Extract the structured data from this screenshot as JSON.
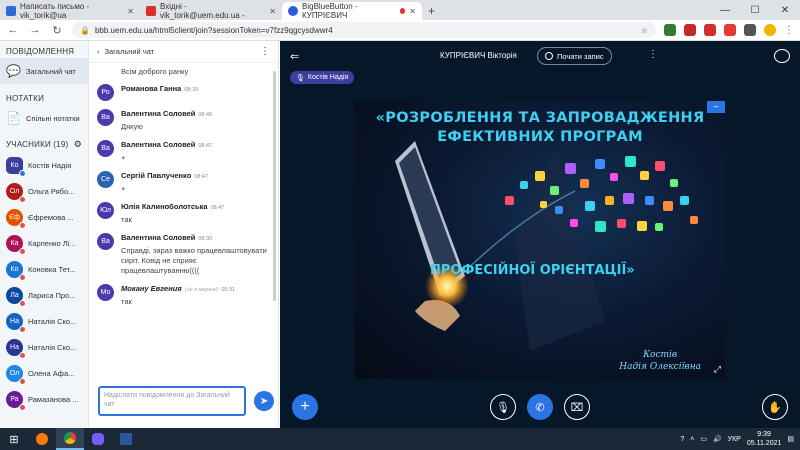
{
  "browser": {
    "tabs": [
      {
        "label": "Написать письмо - vik_torik@ua",
        "fav_color": "#2a6bd5",
        "active": false
      },
      {
        "label": "Вхідні - vik_torik@uem.edu.ua - ",
        "fav_color": "#d93025",
        "active": false
      },
      {
        "label": "BigBlueButton - КУПРІЄВИЧ",
        "fav_color": "#2a5bd8",
        "active": true
      }
    ],
    "new_tab": "+",
    "url": "bbb.uem.edu.ua/html5client/join?sessionToken=v7fzz9qgcysdwwr4"
  },
  "nav": {
    "messages_header": "ПОВІДОМЛЕННЯ",
    "public_chat": "Загальний чат",
    "notes_header": "НОТАТКИ",
    "shared_notes": "Спільні нотатки",
    "participants_header": "УЧАСНИКИ (19)",
    "participants": [
      {
        "initials": "Ко",
        "name": "Костів Надія",
        "color": "#3d3f9e",
        "shape": "square",
        "presenter": true
      },
      {
        "initials": "Ол",
        "name": "Ольга Рябо...",
        "color": "#b71c1c",
        "shape": "round"
      },
      {
        "initials": "Єф",
        "name": "Єфремова ...",
        "color": "#e65100",
        "shape": "round"
      },
      {
        "initials": "Ка",
        "name": "Карпенко Лі...",
        "color": "#ad1457",
        "shape": "round"
      },
      {
        "initials": "Ко",
        "name": "Коновка Тет...",
        "color": "#1976d2",
        "shape": "round"
      },
      {
        "initials": "Ла",
        "name": "Лариса Про...",
        "color": "#0d47a1",
        "shape": "round"
      },
      {
        "initials": "На",
        "name": "Наталія Ско...",
        "color": "#1565c0",
        "shape": "round"
      },
      {
        "initials": "На",
        "name": "Наталія Ско...",
        "color": "#283593",
        "shape": "round"
      },
      {
        "initials": "Ол",
        "name": "Олена Афа...",
        "color": "#1e88e5",
        "shape": "round"
      },
      {
        "initials": "Ра",
        "name": "Рамазанова ...",
        "color": "#6a1b9a",
        "shape": "round"
      }
    ]
  },
  "chat": {
    "title": "Загальний чат",
    "first_line": "Всім доброго ранку",
    "messages": [
      {
        "initials": "Ро",
        "name": "Романова Ганна",
        "time": "08:39",
        "text": "",
        "color": "#4a3ab0"
      },
      {
        "initials": "Ва",
        "name": "Валентина Соловей",
        "time": "08:46",
        "text": "Дякую",
        "color": "#4a3ab0"
      },
      {
        "initials": "Ва",
        "name": "Валентина Соловей",
        "time": "08:47",
        "text": "+",
        "color": "#4a3ab0"
      },
      {
        "initials": "Се",
        "name": "Сергій Павлученко",
        "time": "08:47",
        "text": "+",
        "color": "#2a64b0"
      },
      {
        "initials": "Юл",
        "name": "Юлія Калиноболотська",
        "time": "08:47",
        "text": "так",
        "color": "#4a3ab0"
      },
      {
        "initials": "Ва",
        "name": "Валентина Соловей",
        "time": "09:30",
        "text": "Справді, зараз важко працевлаштовувати сиріт. Ковід не сприяє працевлаштуванню((((",
        "color": "#4a3ab0"
      },
      {
        "initials": "Мо",
        "name": "Мокану Евгения",
        "time": "09:31",
        "offline": "(не в мережі)",
        "text": "так",
        "color": "#4a3ab0"
      }
    ],
    "input_placeholder": "Надіслати повідомлення до Загальний чат"
  },
  "stage": {
    "meeting_title": "КУПРІЄВИЧ Вікторія",
    "record_label": "Почати запис",
    "talker": "Костів Надія",
    "slide": {
      "title": "«РОЗРОБЛЕННЯ ТА ЗАПРОВАДЖЕННЯ ЕФЕКТИВНИХ ПРОГРАМ",
      "subtitle": "ПРОФЕСІЙНОЇ ОРІЄНТАЦІЇ»",
      "author_line1": "Костів",
      "author_line2": "Надія Олексіївна"
    }
  },
  "taskbar": {
    "lang": "УКР",
    "time": "9:39",
    "date": "05.11.2021"
  }
}
